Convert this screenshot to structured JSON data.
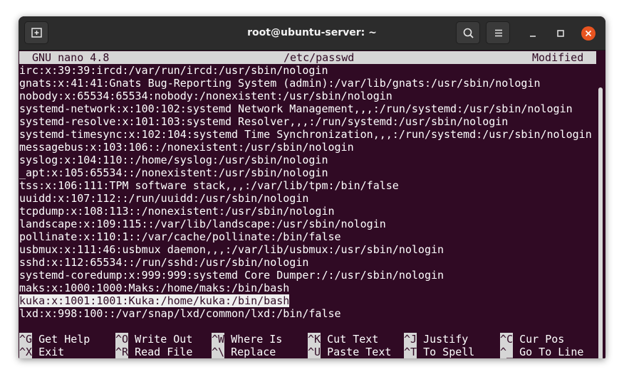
{
  "window": {
    "title": "root@ubuntu-server: ~",
    "new_tab_icon": "new-tab-icon",
    "search_icon": "search-icon",
    "menu_icon": "hamburger-menu-icon",
    "minimize_icon": "minimize-icon",
    "maximize_icon": "maximize-icon",
    "close_icon": "close-icon",
    "close_color": "#e95420"
  },
  "nano": {
    "version": "GNU nano 4.8",
    "filename": "/etc/passwd",
    "status": "Modified"
  },
  "file_lines": [
    "irc:x:39:39:ircd:/var/run/ircd:/usr/sbin/nologin",
    "gnats:x:41:41:Gnats Bug-Reporting System (admin):/var/lib/gnats:/usr/sbin/nologin",
    "nobody:x:65534:65534:nobody:/nonexistent:/usr/sbin/nologin",
    "systemd-network:x:100:102:systemd Network Management,,,:/run/systemd:/usr/sbin/nologin",
    "systemd-resolve:x:101:103:systemd Resolver,,,:/run/systemd:/usr/sbin/nologin",
    "systemd-timesync:x:102:104:systemd Time Synchronization,,,:/run/systemd:/usr/sbin/nologin",
    "messagebus:x:103:106::/nonexistent:/usr/sbin/nologin",
    "syslog:x:104:110::/home/syslog:/usr/sbin/nologin",
    "_apt:x:105:65534::/nonexistent:/usr/sbin/nologin",
    "tss:x:106:111:TPM software stack,,,:/var/lib/tpm:/bin/false",
    "uuidd:x:107:112::/run/uuidd:/usr/sbin/nologin",
    "tcpdump:x:108:113::/nonexistent:/usr/sbin/nologin",
    "landscape:x:109:115::/var/lib/landscape:/usr/sbin/nologin",
    "pollinate:x:110:1::/var/cache/pollinate:/bin/false",
    "usbmux:x:111:46:usbmux daemon,,,:/var/lib/usbmux:/usr/sbin/nologin",
    "sshd:x:112:65534::/run/sshd:/usr/sbin/nologin",
    "systemd-coredump:x:999:999:systemd Core Dumper:/:/usr/sbin/nologin",
    "maks:x:1000:1000:Maks:/home/maks:/bin/bash",
    "kuka:x:1001:1001:Kuka:/home/kuka:/bin/bash",
    "lxd:x:998:100::/var/snap/lxd/common/lxd:/bin/false"
  ],
  "shortcuts": [
    {
      "key": "^G",
      "label": "Get Help"
    },
    {
      "key": "^O",
      "label": "Write Out"
    },
    {
      "key": "^W",
      "label": "Where Is"
    },
    {
      "key": "^K",
      "label": "Cut Text"
    },
    {
      "key": "^J",
      "label": "Justify"
    },
    {
      "key": "^C",
      "label": "Cur Pos"
    },
    {
      "key": "^X",
      "label": "Exit"
    },
    {
      "key": "^R",
      "label": "Read File"
    },
    {
      "key": "^\\",
      "label": "Replace"
    },
    {
      "key": "^U",
      "label": "Paste Text"
    },
    {
      "key": "^T",
      "label": "To Spell"
    },
    {
      "key": "^_",
      "label": "Go To Line"
    }
  ]
}
